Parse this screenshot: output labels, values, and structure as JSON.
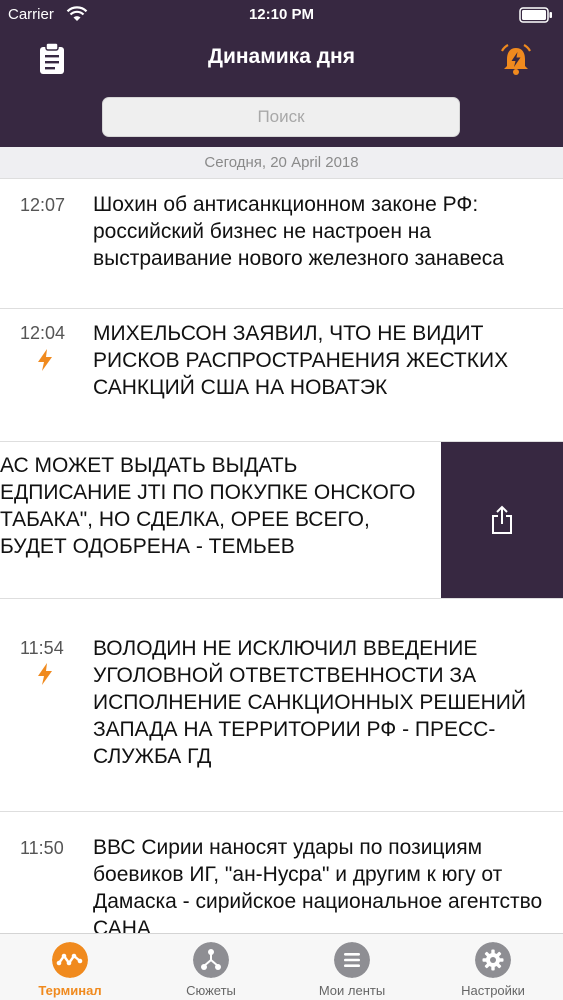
{
  "status_bar": {
    "carrier": "Carrier",
    "time": "12:10 PM"
  },
  "nav": {
    "title": "Динамика дня"
  },
  "search": {
    "placeholder": "Поиск"
  },
  "date_header": "Сегодня, 20 April 2018",
  "news": [
    {
      "time": "12:07",
      "urgent": false,
      "text": "Шохин об антисанкционном законе РФ: российский бизнес не настроен на выстраивание нового железного занавеса"
    },
    {
      "time": "12:04",
      "urgent": true,
      "text": "МИХЕЛЬСОН ЗАЯВИЛ, ЧТО НЕ ВИДИТ РИСКОВ РАСПРОСТРАНЕНИЯ ЖЕСТКИХ САНКЦИЙ США НА НОВАТЭК"
    },
    {
      "time": "",
      "urgent": false,
      "text": "АС МОЖЕТ ВЫДАТЬ ВЫДАТЬ ЕДПИСАНИЕ JTI ПО ПОКУПКЕ ОНСКОГО ТАБАКА\", НО СДЕЛКА, ОРЕЕ ВСЕГО, БУДЕТ ОДОБРЕНА - ТЕМЬЕВ"
    },
    {
      "time": "11:54",
      "urgent": true,
      "text": "ВОЛОДИН НЕ ИСКЛЮЧИЛ ВВЕДЕНИЕ УГОЛОВНОЙ ОТВЕТСТВЕННОСТИ ЗА ИСПОЛНЕНИЕ САНКЦИОННЫХ РЕШЕНИЙ ЗАПАДА НА ТЕРРИТОРИИ РФ - ПРЕСС-СЛУЖБА ГД"
    },
    {
      "time": "11:50",
      "urgent": false,
      "text": "ВВС Сирии наносят удары по позициям боевиков ИГ, \"ан-Нусра\" и другим к югу от Дамаска - сирийское национальное агентство САНА"
    }
  ],
  "tabs": [
    {
      "label": "Терминал",
      "active": true
    },
    {
      "label": "Сюжеты",
      "active": false
    },
    {
      "label": "Мои ленты",
      "active": false
    },
    {
      "label": "Настройки",
      "active": false
    }
  ],
  "colors": {
    "header_bg": "#372841",
    "accent": "#f08a1e",
    "tab_inactive": "#8e8e93"
  }
}
